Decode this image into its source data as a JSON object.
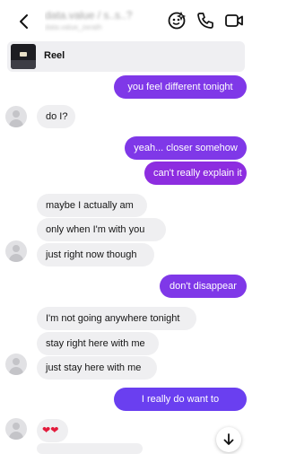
{
  "header": {
    "name_text": "data.value / s..s..?",
    "sub_text": "data.value_zerath"
  },
  "reel": {
    "label": "Reel"
  },
  "messages": [
    {
      "text": "you feel different tonight"
    },
    {
      "text": "do I?"
    },
    {
      "text": "yeah... closer somehow"
    },
    {
      "text": "can't really explain it"
    },
    {
      "text": "maybe I actually am"
    },
    {
      "text": "only when I'm with you"
    },
    {
      "text": "just right now though"
    },
    {
      "text": "don't disappear"
    },
    {
      "text": "I'm not going anywhere tonight"
    },
    {
      "text": "stay right here with me"
    },
    {
      "text": "just stay here with me"
    },
    {
      "text": "I really do want to"
    }
  ],
  "reaction": {
    "hearts": "❤❤"
  },
  "colors": {
    "outgoing_bubble": "#7f38e8",
    "incoming_bubble": "#efeff1",
    "heart": "#e31b3c"
  }
}
